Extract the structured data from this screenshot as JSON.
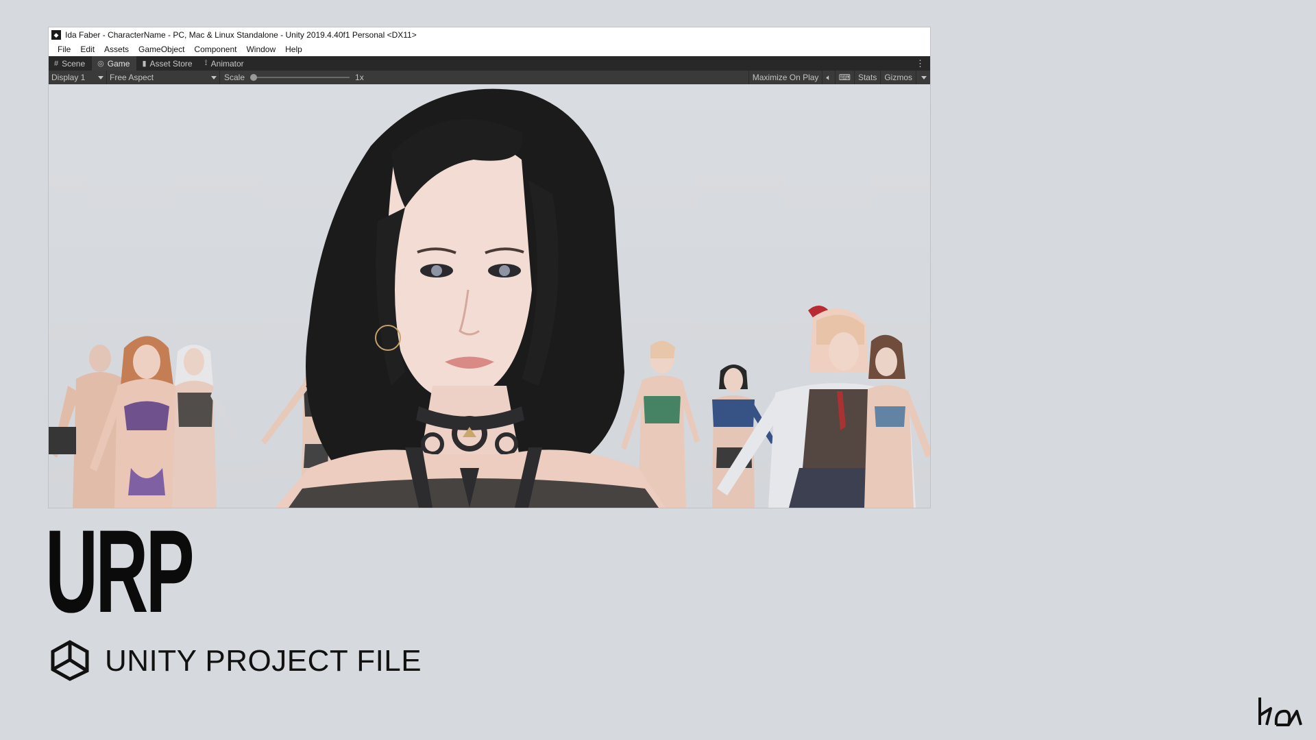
{
  "window": {
    "title": "Ida Faber - CharacterName - PC, Mac & Linux Standalone - Unity 2019.4.40f1 Personal <DX11>",
    "menu": [
      "File",
      "Edit",
      "Assets",
      "GameObject",
      "Component",
      "Window",
      "Help"
    ],
    "tabs": [
      {
        "label": "Scene",
        "icon": "grid-icon"
      },
      {
        "label": "Game",
        "icon": "gamepad-icon"
      },
      {
        "label": "Asset Store",
        "icon": "bag-icon"
      },
      {
        "label": "Animator",
        "icon": "animator-icon"
      }
    ],
    "toolbar": {
      "display": "Display 1",
      "aspect": "Free Aspect",
      "scale_label": "Scale",
      "scale_value": "1x",
      "maximize": "Maximize On Play",
      "stats": "Stats",
      "gizmos": "Gizmos"
    }
  },
  "hero": {
    "title": "URP",
    "subtitle": "UNITY PROJECT FILE"
  },
  "colors": {
    "background": "#d6dade",
    "tab_bar": "#282828",
    "toolbar": "#3a3a3a"
  }
}
